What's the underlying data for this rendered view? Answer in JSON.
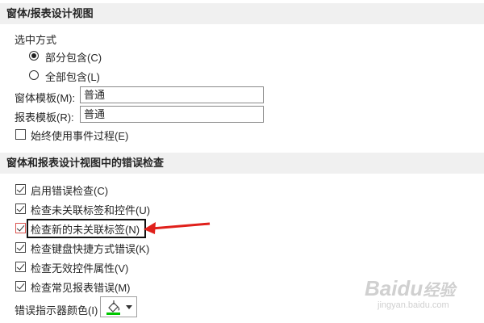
{
  "section1": {
    "title": "窗体/报表设计视图",
    "selection_group_label": "选中方式",
    "radio_partial": "部分包含(C)",
    "radio_full": "全部包含(L)",
    "form_template_label": "窗体模板(M):",
    "form_template_value": "普通",
    "report_template_label": "报表模板(R):",
    "report_template_value": "普通",
    "always_use_event_procedures": "始终使用事件过程(E)"
  },
  "section2": {
    "title": "窗体和报表设计视图中的错误检查",
    "items": [
      {
        "label": "启用错误检查(C)",
        "checked": true
      },
      {
        "label": "检查未关联标签和控件(U)",
        "checked": true
      },
      {
        "label": "检查新的未关联标签(N)",
        "checked": true
      },
      {
        "label": "检查键盘快捷方式错误(K)",
        "checked": true
      },
      {
        "label": "检查无效控件属性(V)",
        "checked": true
      },
      {
        "label": "检查常见报表错误(M)",
        "checked": true
      }
    ],
    "error_indicator_color_label": "错误指示器颜色(I)",
    "error_indicator_color": "#00c800"
  },
  "watermark": {
    "brand": "Baidu",
    "brand_cn": "经验",
    "url": "jingyan.baidu.com"
  },
  "colors": {
    "header_bg": "#f0f0f0",
    "arrow": "#e0201b",
    "highlight_checkbox_border": "#d9534f"
  }
}
